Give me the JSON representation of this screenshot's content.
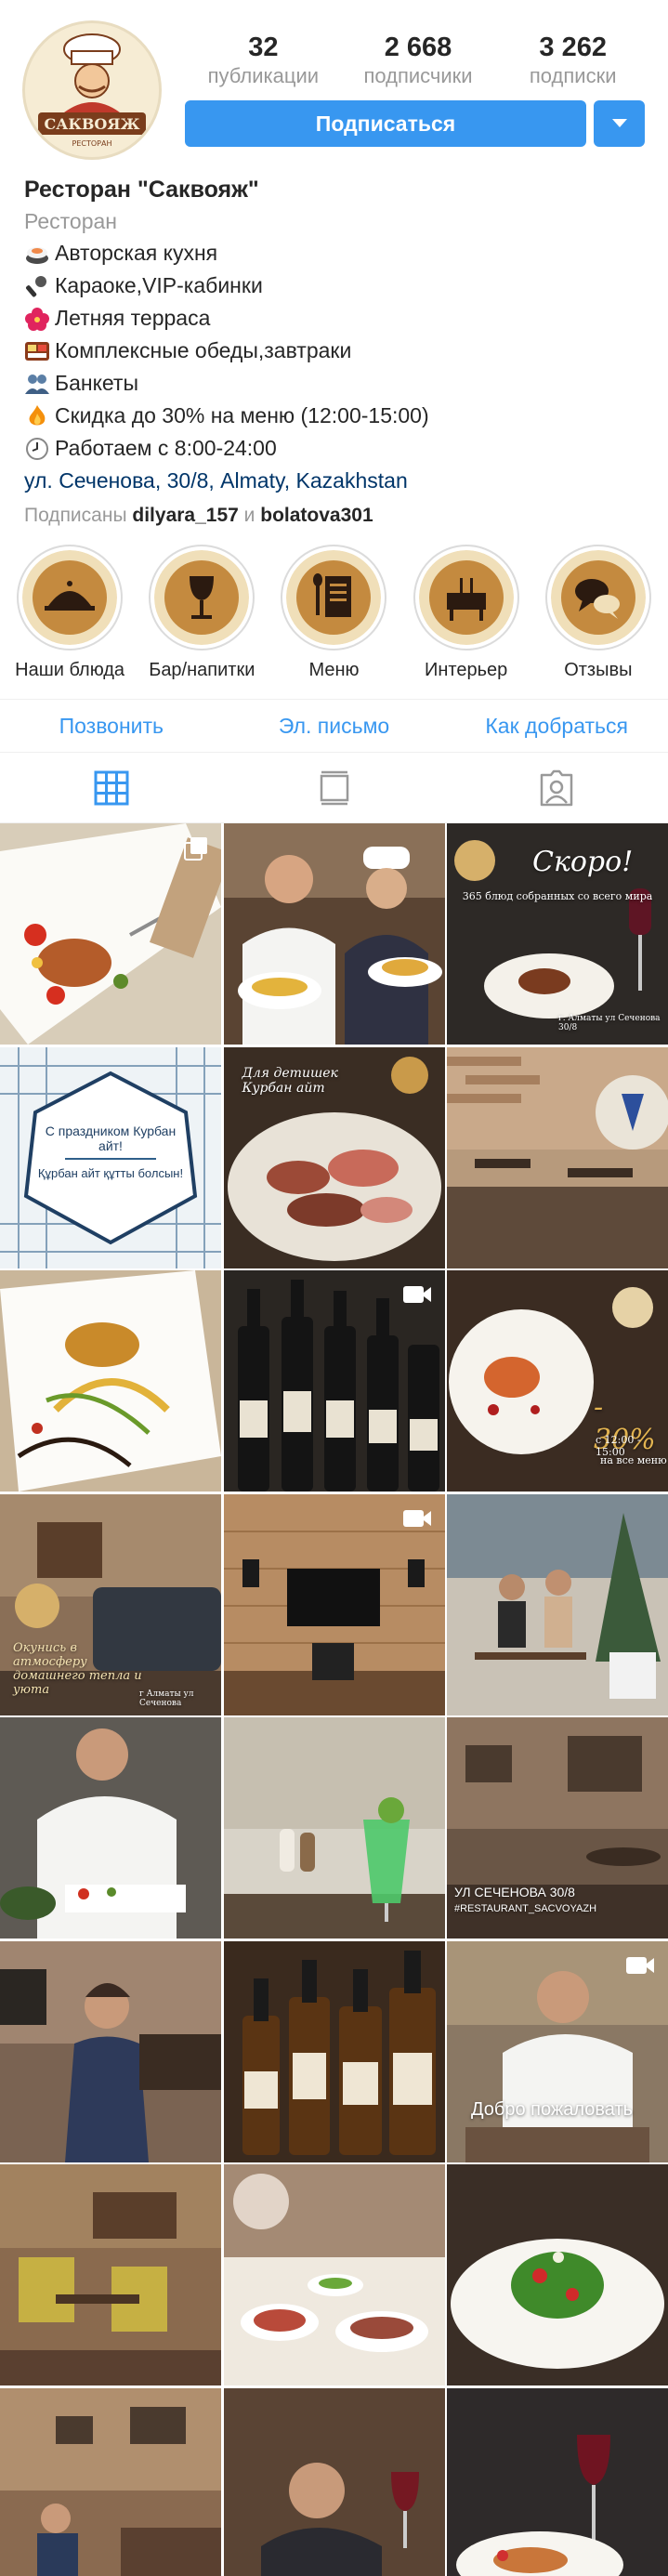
{
  "profile": {
    "logo_text": "САКВОЯЖ",
    "logo_subtext": "РЕСТОРАН",
    "stats": [
      {
        "value": "32",
        "label": "публикации"
      },
      {
        "value": "2 668",
        "label": "подписчики"
      },
      {
        "value": "3 262",
        "label": "подписки"
      }
    ],
    "follow_label": "Подписаться",
    "accent_color": "#3897f0"
  },
  "bio": {
    "name": "Ресторан \"Саквояж\"",
    "category": "Ресторан",
    "lines": [
      {
        "icon": "sushi-icon",
        "text": "Авторская кухня"
      },
      {
        "icon": "microphone-icon",
        "text": "Караоке,VIP-кабинки"
      },
      {
        "icon": "hibiscus-icon",
        "text": "Летняя терраса"
      },
      {
        "icon": "bento-box-icon",
        "text": "Комплексные обеды,завтраки"
      },
      {
        "icon": "people-icon",
        "text": "Банкеты"
      },
      {
        "icon": "fire-icon",
        "text": "Скидка до 30% на меню (12:00-15:00)"
      },
      {
        "icon": "clock-icon",
        "text": "Работаем с 8:00-24:00"
      }
    ],
    "address": "ул. Сеченова, 30/8, Almaty, Kazakhstan",
    "followed_prefix": "Подписаны",
    "followed_user1": "dilyara_157",
    "followed_and": "и",
    "followed_user2": "bolatova301"
  },
  "highlights": [
    {
      "label": "Наши блюда",
      "icon": "cloche-icon"
    },
    {
      "label": "Бар/напитки",
      "icon": "wine-glass-icon"
    },
    {
      "label": "Меню",
      "icon": "menu-book-icon"
    },
    {
      "label": "Интерьер",
      "icon": "table-icon"
    },
    {
      "label": "Отзывы",
      "icon": "speech-bubbles-icon"
    }
  ],
  "contacts": {
    "call": "Позвонить",
    "email": "Эл. письмо",
    "directions": "Как добраться"
  },
  "tabs": [
    {
      "name": "grid-view",
      "icon": "grid-icon",
      "active": true
    },
    {
      "name": "feed-view",
      "icon": "feed-icon",
      "active": false
    },
    {
      "name": "tagged",
      "icon": "tagged-person-icon",
      "active": false
    }
  ],
  "posts": [
    {
      "kind": "multiple",
      "caption": ""
    },
    {
      "kind": "photo",
      "caption": ""
    },
    {
      "kind": "photo",
      "caption": "Скоро!",
      "sub": "365 блюд собранных со всего мира",
      "extra": "г. Алматы ул Сеченова 30/8"
    },
    {
      "kind": "photo",
      "caption": "С праздником Курбан айт!",
      "sub": "Құрбан айт құтты болсын!"
    },
    {
      "kind": "photo",
      "caption": "Для детишек Курбан айт"
    },
    {
      "kind": "photo",
      "caption": ""
    },
    {
      "kind": "photo",
      "caption": ""
    },
    {
      "kind": "video",
      "caption": ""
    },
    {
      "kind": "photo",
      "caption": "- 30%",
      "sub": "с 12:00 - 15:00",
      "extra": "на все меню"
    },
    {
      "kind": "photo",
      "caption": "Окунись в атмосферу домашнего тепла и уюта",
      "extra": "г Алматы ул Сеченова"
    },
    {
      "kind": "video",
      "caption": ""
    },
    {
      "kind": "photo",
      "caption": ""
    },
    {
      "kind": "photo",
      "caption": ""
    },
    {
      "kind": "photo",
      "caption": ""
    },
    {
      "kind": "photo",
      "caption": "УЛ СЕЧЕНОВА 30/8",
      "sub": "#RESTAURANT_SACVOYAZH"
    },
    {
      "kind": "photo",
      "caption": ""
    },
    {
      "kind": "photo",
      "caption": ""
    },
    {
      "kind": "video",
      "caption": "Добро пожаловать"
    },
    {
      "kind": "photo",
      "caption": ""
    },
    {
      "kind": "photo",
      "caption": ""
    },
    {
      "kind": "photo",
      "caption": ""
    },
    {
      "kind": "photo",
      "caption": ""
    },
    {
      "kind": "photo",
      "caption": ""
    },
    {
      "kind": "photo",
      "caption": ""
    }
  ]
}
